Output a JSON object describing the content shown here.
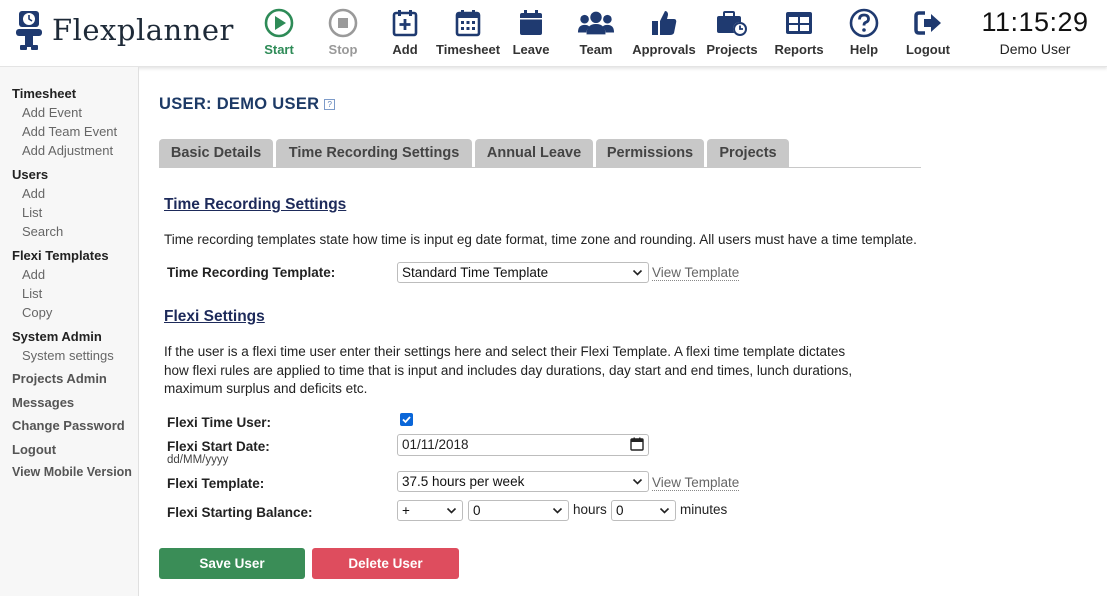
{
  "app": {
    "logo_text": "Flexplanner"
  },
  "nav": {
    "start": "Start",
    "stop": "Stop",
    "add": "Add",
    "timesheet": "Timesheet",
    "leave": "Leave",
    "team": "Team",
    "approvals": "Approvals",
    "projects": "Projects",
    "reports": "Reports",
    "help": "Help",
    "logout": "Logout"
  },
  "clock": {
    "time": "11:15:29",
    "user": "Demo User"
  },
  "sidebar": {
    "timesheet": {
      "head": "Timesheet",
      "items": [
        "Add Event",
        "Add Team Event",
        "Add Adjustment"
      ]
    },
    "users": {
      "head": "Users",
      "items": [
        "Add",
        "List",
        "Search"
      ]
    },
    "flexi_templates": {
      "head": "Flexi Templates",
      "items": [
        "Add",
        "List",
        "Copy"
      ]
    },
    "system_admin": {
      "head": "System Admin",
      "items": [
        "System settings"
      ]
    },
    "links": [
      "Projects Admin",
      "Messages",
      "Change Password",
      "Logout",
      "View Mobile Version"
    ]
  },
  "page": {
    "title": "USER: DEMO USER",
    "help_icon": "?"
  },
  "tabs": [
    "Basic Details",
    "Time Recording Settings",
    "Annual Leave",
    "Permissions",
    "Projects"
  ],
  "time_recording": {
    "title": "Time Recording Settings",
    "description": "Time recording templates state how time is input eg date format, time zone and rounding.  All users must have a time template.",
    "template_label": "Time Recording Template:",
    "template_value": "Standard Time Template",
    "view_link": "View Template"
  },
  "flexi": {
    "title": "Flexi Settings",
    "desc1": "If the user is a flexi time user enter their settings here and select their Flexi Template.  A flexi time template dictates",
    "desc2": "how flexi rules are applied to time that is input and includes day durations, day start and end times, lunch durations,",
    "desc3": "maximum surplus and deficits etc.",
    "user_label": "Flexi Time User:",
    "user_checked": true,
    "start_label": "Flexi Start Date:",
    "start_hint": "dd/MM/yyyy",
    "start_value": "01/11/2018",
    "template_label": "Flexi Template:",
    "template_value": "37.5 hours per week",
    "view_link": "View Template",
    "balance_label": "Flexi Starting Balance:",
    "sign_value": "+",
    "hours_value": "0",
    "hours_text": "hours",
    "minutes_value": "0",
    "minutes_text": "minutes"
  },
  "buttons": {
    "save": "Save User",
    "delete": "Delete User"
  },
  "colors": {
    "brand": "#1d3a66",
    "save": "#3a8d57",
    "delete": "#de4d5e",
    "start": "#2e8b57",
    "nav_icon": "#1f3a70"
  }
}
